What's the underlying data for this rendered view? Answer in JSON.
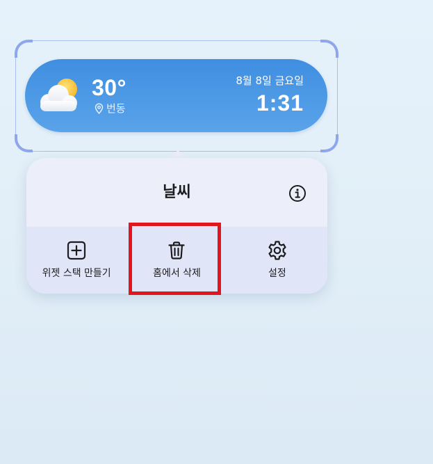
{
  "widget": {
    "icon": "partly-cloudy-icon",
    "temperature": "30°",
    "location": "번동",
    "location_icon": "location-pin-icon",
    "date": "8월 8일 금요일",
    "time": "1:31",
    "background_color": "#4a95e4"
  },
  "menu": {
    "title": "날씨",
    "info_icon": "info-icon",
    "actions": [
      {
        "label": "위젯 스택 만들기",
        "icon": "add-square-icon"
      },
      {
        "label": "홈에서 삭제",
        "icon": "trash-icon"
      },
      {
        "label": "설정",
        "icon": "gear-icon"
      }
    ]
  },
  "highlight": {
    "target": "홈에서 삭제",
    "color": "#e0151d"
  }
}
